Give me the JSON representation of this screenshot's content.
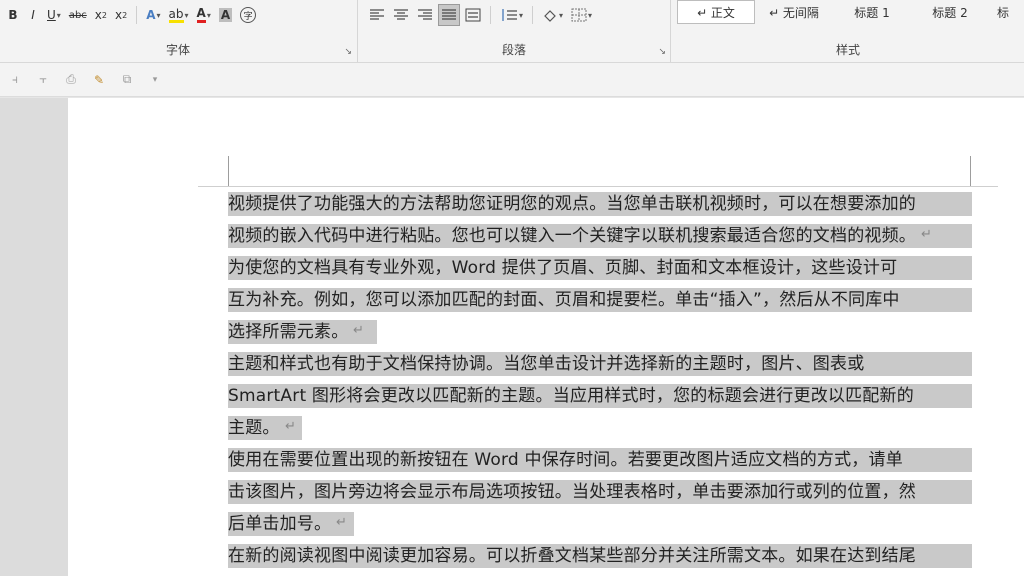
{
  "ribbon": {
    "font_group": {
      "label": "字体",
      "buttons": [
        {
          "name": "bold-button",
          "glyph": "B"
        },
        {
          "name": "italic-button",
          "glyph": "I"
        },
        {
          "name": "underline-button",
          "glyph": "U"
        },
        {
          "name": "strikethrough-button",
          "glyph": "abc"
        },
        {
          "name": "subscript-button",
          "glyph": "x₂"
        },
        {
          "name": "superscript-button",
          "glyph": "x²"
        }
      ]
    },
    "paragraph_group": {
      "label": "段落"
    },
    "styles_group": {
      "label": "样式",
      "items": [
        {
          "label": "↵ 正文",
          "active": true
        },
        {
          "label": "↵ 无间隔",
          "active": false
        },
        {
          "label": "标题 1",
          "active": false
        },
        {
          "label": "标题 2",
          "active": false
        },
        {
          "label": "标",
          "active": false
        }
      ]
    }
  },
  "colors": {
    "selection_highlight": "#c9c9c9",
    "font_color_underline": "#e02020",
    "highlight_underline": "#f7e000"
  },
  "document": {
    "lines": [
      {
        "text": "视频提供了功能强大的方法帮助您证明您的观点。当您单击联机视频时，可以在想要添加的",
        "mark": "",
        "fill": 1.0
      },
      {
        "text": "视频的嵌入代码中进行粘贴。您也可以键入一个关键字以联机搜索最适合您的文档的视频。",
        "mark": "↵",
        "fill": 1.0
      },
      {
        "text": "为使您的文档具有专业外观，Word 提供了页眉、页脚、封面和文本框设计，这些设计可",
        "mark": "",
        "fill": 1.0
      },
      {
        "text": "互为补充。例如，您可以添加匹配的封面、页眉和提要栏。单击“插入”，然后从不同库中",
        "mark": "",
        "fill": 1.0
      },
      {
        "text": "选择所需元素。",
        "mark": "↵",
        "fill": 0.2
      },
      {
        "text": "主题和样式也有助于文档保持协调。当您单击设计并选择新的主题时，图片、图表或",
        "mark": "",
        "fill": 1.0
      },
      {
        "text": "SmartArt 图形将会更改以匹配新的主题。当应用样式时，您的标题会进行更改以匹配新的",
        "mark": "",
        "fill": 1.0
      },
      {
        "text": "主题。",
        "mark": "↵",
        "fill": 0.1
      },
      {
        "text": "使用在需要位置出现的新按钮在 Word 中保存时间。若要更改图片适应文档的方式，请单",
        "mark": "",
        "fill": 1.0
      },
      {
        "text": "击该图片，图片旁边将会显示布局选项按钮。当处理表格时，单击要添加行或列的位置，然",
        "mark": "",
        "fill": 1.0
      },
      {
        "text": "后单击加号。",
        "mark": "↵",
        "fill": 0.17
      },
      {
        "text": "在新的阅读视图中阅读更加容易。可以折叠文档某些部分并关注所需文本。如果在达到结尾",
        "mark": "",
        "fill": 1.0
      }
    ]
  }
}
